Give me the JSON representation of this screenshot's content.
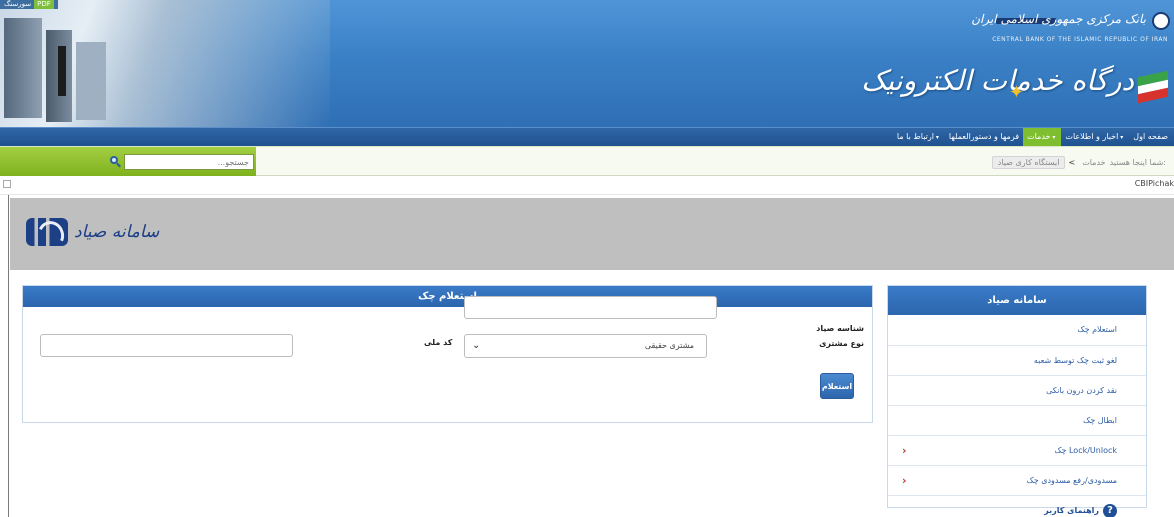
{
  "header": {
    "top_tag": "سورسنگ",
    "top_tag_badge": "PDF",
    "bank_name_fa": "بانک مرکزی جمهوری اسلامی ایران",
    "bank_name_en": "CENTRAL BANK OF THE ISLAMIC REPUBLIC OF IRAN",
    "portal_title": "درگاه خدمات الکترونیک"
  },
  "nav": {
    "items": [
      {
        "label": "صفحه اول",
        "dropdown": false,
        "active": false
      },
      {
        "label": "اخبار و اطلاعات",
        "dropdown": true,
        "active": false
      },
      {
        "label": "خدمات",
        "dropdown": true,
        "active": true
      },
      {
        "label": "فرمها و دستورالعملها",
        "dropdown": false,
        "active": false
      },
      {
        "label": "ارتباط با ما",
        "dropdown": true,
        "active": false
      }
    ]
  },
  "search": {
    "placeholder": "جستجو..."
  },
  "breadcrumb": {
    "prefix": "شما اینجا هستید:",
    "items": [
      "خدمات",
      "ایستگاه کاری صیاد"
    ],
    "separator": "<"
  },
  "page_name": "CBIPichak",
  "sayad_logo_text": "سامانه صیاد",
  "form": {
    "title": "استعلام چک",
    "sayad_id_label": "شناسه صیاد",
    "sayad_id_value": "",
    "customer_type_label": "نوع مشتری",
    "customer_type_selected": "مشتری حقیقی",
    "national_code_label": "کد ملی",
    "national_code_value": "",
    "submit_label": "استعلام"
  },
  "sidebar": {
    "title": "سامانه صیاد",
    "items": [
      {
        "label": "استعلام چک",
        "has_chevron": false
      },
      {
        "label": "لغو ثبت چک توسط شعبه",
        "has_chevron": false
      },
      {
        "label": "نقد کردن درون بانکی",
        "has_chevron": false
      },
      {
        "label": "ابطال چک",
        "has_chevron": false
      },
      {
        "label": "Lock/Unlock چک",
        "has_chevron": true
      },
      {
        "label": "مسدودی/رفع مسدودی چک",
        "has_chevron": true
      }
    ],
    "help_label": "راهنمای کاربر"
  },
  "colors": {
    "header_blue": "#3a80c6",
    "nav_blue": "#1f5190",
    "nav_active_green": "#7fbe2e",
    "panel_blue": "#2b66ae",
    "gray_band": "#bfbfbf",
    "chevron_red": "#c0392b"
  },
  "icons": {
    "search": "magnifier-icon",
    "nav_caret": "caret-down-icon",
    "sidebar_chevron": "chevron-left-icon",
    "help": "question-circle-icon",
    "select_arrow": "chevron-down-icon"
  }
}
